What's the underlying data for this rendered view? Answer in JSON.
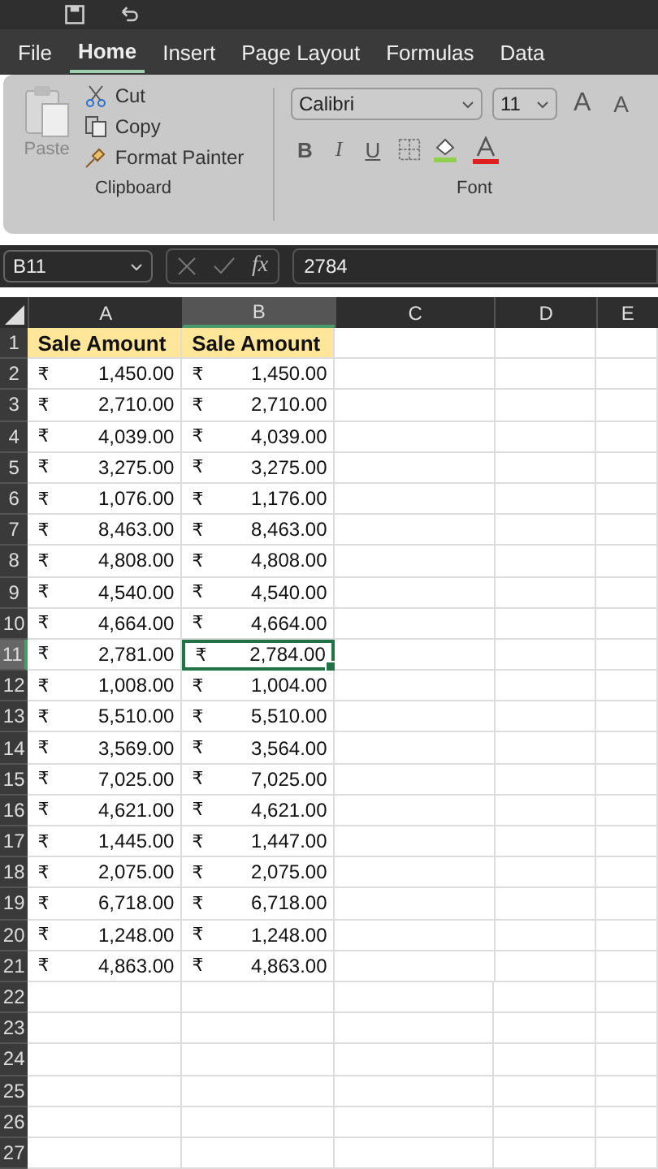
{
  "tabs": [
    {
      "label": "File",
      "selected": false
    },
    {
      "label": "Home",
      "selected": true
    },
    {
      "label": "Insert",
      "selected": false
    },
    {
      "label": "Page Layout",
      "selected": false
    },
    {
      "label": "Formulas",
      "selected": false
    },
    {
      "label": "Data",
      "selected": false
    }
  ],
  "clipboard": {
    "paste": "Paste",
    "cut": "Cut",
    "copy": "Copy",
    "format_painter": "Format Painter",
    "label": "Clipboard"
  },
  "font": {
    "name": "Calibri",
    "size": "11",
    "bold": "B",
    "italic": "I",
    "underline": "U",
    "grow": "A",
    "shrink": "A",
    "label": "Font"
  },
  "formula_bar": {
    "name_box": "B11",
    "fx": "fx",
    "formula": "2784"
  },
  "columns": [
    {
      "label": "A",
      "selected": false
    },
    {
      "label": "B",
      "selected": true
    },
    {
      "label": "C",
      "selected": false
    },
    {
      "label": "D",
      "selected": false
    },
    {
      "label": "E",
      "selected": false
    }
  ],
  "rows": [
    {
      "number": "1",
      "selected": false,
      "cells": [
        {
          "kind": "header",
          "text": "Sale Amount",
          "selected": false
        },
        {
          "kind": "header",
          "text": "Sale Amount",
          "selected": false
        }
      ]
    },
    {
      "number": "2",
      "selected": false,
      "cells": [
        {
          "kind": "currency",
          "symbol": "₹",
          "text": "1,450.00",
          "selected": false
        },
        {
          "kind": "currency",
          "symbol": "₹",
          "text": "1,450.00",
          "selected": false
        }
      ]
    },
    {
      "number": "3",
      "selected": false,
      "cells": [
        {
          "kind": "currency",
          "symbol": "₹",
          "text": "2,710.00",
          "selected": false
        },
        {
          "kind": "currency",
          "symbol": "₹",
          "text": "2,710.00",
          "selected": false
        }
      ]
    },
    {
      "number": "4",
      "selected": false,
      "cells": [
        {
          "kind": "currency",
          "symbol": "₹",
          "text": "4,039.00",
          "selected": false
        },
        {
          "kind": "currency",
          "symbol": "₹",
          "text": "4,039.00",
          "selected": false
        }
      ]
    },
    {
      "number": "5",
      "selected": false,
      "cells": [
        {
          "kind": "currency",
          "symbol": "₹",
          "text": "3,275.00",
          "selected": false
        },
        {
          "kind": "currency",
          "symbol": "₹",
          "text": "3,275.00",
          "selected": false
        }
      ]
    },
    {
      "number": "6",
      "selected": false,
      "cells": [
        {
          "kind": "currency",
          "symbol": "₹",
          "text": "1,076.00",
          "selected": false
        },
        {
          "kind": "currency",
          "symbol": "₹",
          "text": "1,176.00",
          "selected": false
        }
      ]
    },
    {
      "number": "7",
      "selected": false,
      "cells": [
        {
          "kind": "currency",
          "symbol": "₹",
          "text": "8,463.00",
          "selected": false
        },
        {
          "kind": "currency",
          "symbol": "₹",
          "text": "8,463.00",
          "selected": false
        }
      ]
    },
    {
      "number": "8",
      "selected": false,
      "cells": [
        {
          "kind": "currency",
          "symbol": "₹",
          "text": "4,808.00",
          "selected": false
        },
        {
          "kind": "currency",
          "symbol": "₹",
          "text": "4,808.00",
          "selected": false
        }
      ]
    },
    {
      "number": "9",
      "selected": false,
      "cells": [
        {
          "kind": "currency",
          "symbol": "₹",
          "text": "4,540.00",
          "selected": false
        },
        {
          "kind": "currency",
          "symbol": "₹",
          "text": "4,540.00",
          "selected": false
        }
      ]
    },
    {
      "number": "10",
      "selected": false,
      "cells": [
        {
          "kind": "currency",
          "symbol": "₹",
          "text": "4,664.00",
          "selected": false
        },
        {
          "kind": "currency",
          "symbol": "₹",
          "text": "4,664.00",
          "selected": false
        }
      ]
    },
    {
      "number": "11",
      "selected": true,
      "cells": [
        {
          "kind": "currency",
          "symbol": "₹",
          "text": "2,781.00",
          "selected": false
        },
        {
          "kind": "currency",
          "symbol": "₹",
          "text": "2,784.00",
          "selected": true
        }
      ]
    },
    {
      "number": "12",
      "selected": false,
      "cells": [
        {
          "kind": "currency",
          "symbol": "₹",
          "text": "1,008.00",
          "selected": false
        },
        {
          "kind": "currency",
          "symbol": "₹",
          "text": "1,004.00",
          "selected": false
        }
      ]
    },
    {
      "number": "13",
      "selected": false,
      "cells": [
        {
          "kind": "currency",
          "symbol": "₹",
          "text": "5,510.00",
          "selected": false
        },
        {
          "kind": "currency",
          "symbol": "₹",
          "text": "5,510.00",
          "selected": false
        }
      ]
    },
    {
      "number": "14",
      "selected": false,
      "cells": [
        {
          "kind": "currency",
          "symbol": "₹",
          "text": "3,569.00",
          "selected": false
        },
        {
          "kind": "currency",
          "symbol": "₹",
          "text": "3,564.00",
          "selected": false
        }
      ]
    },
    {
      "number": "15",
      "selected": false,
      "cells": [
        {
          "kind": "currency",
          "symbol": "₹",
          "text": "7,025.00",
          "selected": false
        },
        {
          "kind": "currency",
          "symbol": "₹",
          "text": "7,025.00",
          "selected": false
        }
      ]
    },
    {
      "number": "16",
      "selected": false,
      "cells": [
        {
          "kind": "currency",
          "symbol": "₹",
          "text": "4,621.00",
          "selected": false
        },
        {
          "kind": "currency",
          "symbol": "₹",
          "text": "4,621.00",
          "selected": false
        }
      ]
    },
    {
      "number": "17",
      "selected": false,
      "cells": [
        {
          "kind": "currency",
          "symbol": "₹",
          "text": "1,445.00",
          "selected": false
        },
        {
          "kind": "currency",
          "symbol": "₹",
          "text": "1,447.00",
          "selected": false
        }
      ]
    },
    {
      "number": "18",
      "selected": false,
      "cells": [
        {
          "kind": "currency",
          "symbol": "₹",
          "text": "2,075.00",
          "selected": false
        },
        {
          "kind": "currency",
          "symbol": "₹",
          "text": "2,075.00",
          "selected": false
        }
      ]
    },
    {
      "number": "19",
      "selected": false,
      "cells": [
        {
          "kind": "currency",
          "symbol": "₹",
          "text": "6,718.00",
          "selected": false
        },
        {
          "kind": "currency",
          "symbol": "₹",
          "text": "6,718.00",
          "selected": false
        }
      ]
    },
    {
      "number": "20",
      "selected": false,
      "cells": [
        {
          "kind": "currency",
          "symbol": "₹",
          "text": "1,248.00",
          "selected": false
        },
        {
          "kind": "currency",
          "symbol": "₹",
          "text": "1,248.00",
          "selected": false
        }
      ]
    },
    {
      "number": "21",
      "selected": false,
      "cells": [
        {
          "kind": "currency",
          "symbol": "₹",
          "text": "4,863.00",
          "selected": false
        },
        {
          "kind": "currency",
          "symbol": "₹",
          "text": "4,863.00",
          "selected": false
        }
      ]
    },
    {
      "number": "22",
      "selected": false,
      "cells": []
    },
    {
      "number": "23",
      "selected": false,
      "cells": []
    },
    {
      "number": "24",
      "selected": false,
      "cells": []
    },
    {
      "number": "25",
      "selected": false,
      "cells": []
    },
    {
      "number": "26",
      "selected": false,
      "cells": []
    },
    {
      "number": "27",
      "selected": false,
      "cells": []
    }
  ]
}
